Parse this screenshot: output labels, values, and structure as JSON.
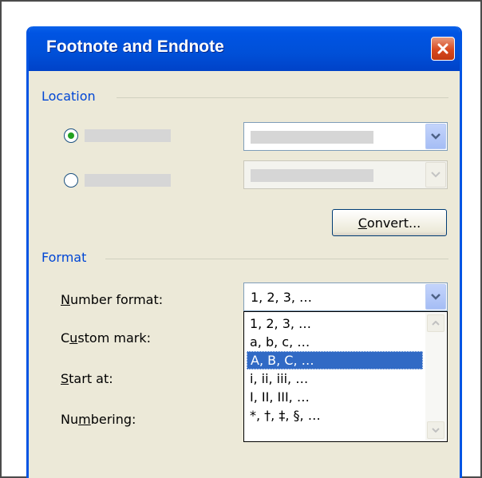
{
  "dialog": {
    "title": "Footnote and Endnote",
    "close_icon": "close-x-icon",
    "accent": "#0054e3"
  },
  "location": {
    "section_label": "Location",
    "convert_button": {
      "prefix": "",
      "mnemonic": "C",
      "suffix": "onvert..."
    }
  },
  "format": {
    "section_label": "Format",
    "number_format": {
      "label": {
        "prefix": "",
        "mnemonic": "N",
        "suffix": "umber format:"
      },
      "selected_value": "1, 2, 3, …",
      "options": [
        "1, 2, 3, …",
        "a, b, c, …",
        "A, B, C, …",
        "i, ii, iii, …",
        "I, II, III, …",
        "*, †, ‡, §, …"
      ],
      "highlighted_index": 2
    },
    "custom_mark_label": {
      "prefix": "C",
      "mnemonic": "u",
      "suffix": "stom mark:"
    },
    "start_at_label": {
      "prefix": "",
      "mnemonic": "S",
      "suffix": "tart at:"
    },
    "numbering_label": {
      "prefix": "Nu",
      "mnemonic": "m",
      "suffix": "bering:"
    }
  }
}
